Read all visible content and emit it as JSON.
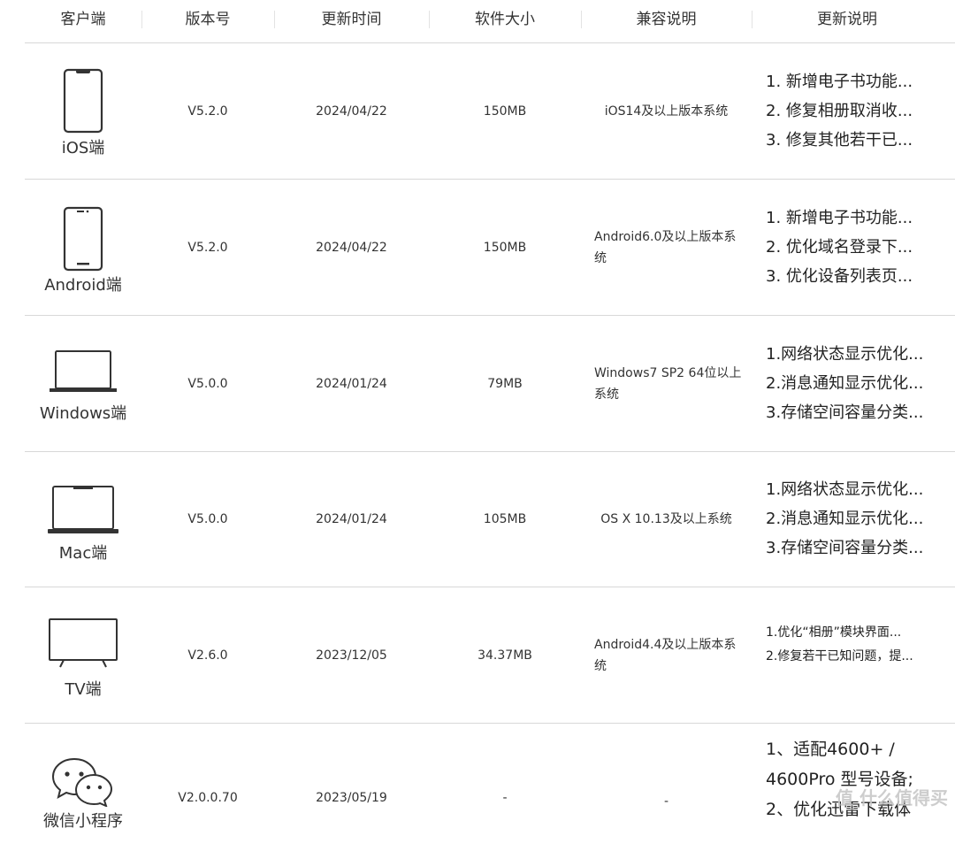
{
  "headers": [
    "客户端",
    "版本号",
    "更新时间",
    "软件大小",
    "兼容说明",
    "更新说明"
  ],
  "rows": [
    {
      "client": "iOS端",
      "icon": "iphone-icon",
      "version": "V5.2.0",
      "date": "2024/04/22",
      "size": "150MB",
      "compat": "iOS14及以上版本系统",
      "notes": [
        "1. 新增电子书功能...",
        "2. 修复相册取消收...",
        "3. 修复其他若干已..."
      ]
    },
    {
      "client": "Android端",
      "icon": "android-phone-icon",
      "version": "V5.2.0",
      "date": "2024/04/22",
      "size": "150MB",
      "compat": "Android6.0及以上版本系统",
      "notes": [
        "1. 新增电子书功能...",
        "2. 优化域名登录下...",
        "3. 优化设备列表页..."
      ]
    },
    {
      "client": "Windows端",
      "icon": "laptop-icon",
      "version": "V5.0.0",
      "date": "2024/01/24",
      "size": "79MB",
      "compat": "Windows7 SP2 64位以上系统",
      "notes": [
        "1.网络状态显示优化...",
        "2.消息通知显示优化...",
        "3.存储空间容量分类..."
      ]
    },
    {
      "client": "Mac端",
      "icon": "macbook-icon",
      "version": "V5.0.0",
      "date": "2024/01/24",
      "size": "105MB",
      "compat": "OS X 10.13及以上系统",
      "notes": [
        "1.网络状态显示优化...",
        "2.消息通知显示优化...",
        "3.存储空间容量分类..."
      ]
    },
    {
      "client": "TV端",
      "icon": "tv-icon",
      "version": "V2.6.0",
      "date": "2023/12/05",
      "size": "34.37MB",
      "compat": "Android4.4及以上版本系统",
      "notes": [
        "1.优化“相册”模块界面...",
        "2.修复若干已知问题，提..."
      ]
    },
    {
      "client": "微信小程序",
      "icon": "wechat-icon",
      "version": "V2.0.0.70",
      "date": "2023/05/19",
      "size": "-",
      "compat": "-",
      "notes": [
        "1、适配4600+ /",
        "4600Pro 型号设备;",
        "2、优化迅雷下载体"
      ]
    }
  ],
  "watermark": "值 什么值得买"
}
